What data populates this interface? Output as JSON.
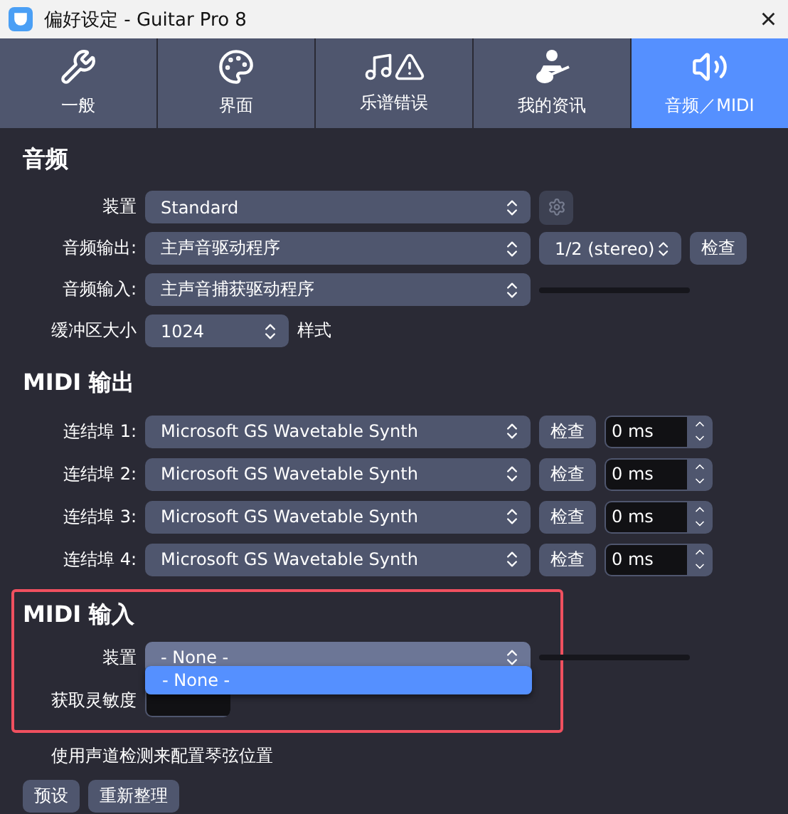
{
  "window": {
    "title": "偏好设定 - Guitar Pro 8",
    "close": "×"
  },
  "tabs": [
    {
      "label": "一般",
      "selected": false
    },
    {
      "label": "界面",
      "selected": false
    },
    {
      "label": "乐谱错误",
      "selected": false
    },
    {
      "label": "我的资讯",
      "selected": false
    },
    {
      "label": "音频／MIDI",
      "selected": true
    }
  ],
  "audio": {
    "heading": "音频",
    "device": {
      "label": "装置",
      "value": "Standard"
    },
    "output": {
      "label": "音频输出:",
      "value": "主声音驱动程序",
      "channel": "1/2 (stereo)",
      "test": "检查"
    },
    "input": {
      "label": "音频输入:",
      "value": "主声音捕获驱动程序"
    },
    "buffer": {
      "label": "缓冲区大小",
      "value": "1024",
      "suffix": "样式"
    }
  },
  "midi_output": {
    "heading": "MIDI 输出",
    "ports": [
      {
        "label": "连结埠 1:",
        "value": "Microsoft GS Wavetable Synth",
        "test": "检查",
        "latency": "0 ms"
      },
      {
        "label": "连结埠 2:",
        "value": "Microsoft GS Wavetable Synth",
        "test": "检查",
        "latency": "0 ms"
      },
      {
        "label": "连结埠 3:",
        "value": "Microsoft GS Wavetable Synth",
        "test": "检查",
        "latency": "0 ms"
      },
      {
        "label": "连结埠 4:",
        "value": "Microsoft GS Wavetable Synth",
        "test": "检查",
        "latency": "0 ms"
      }
    ]
  },
  "midi_input": {
    "heading": "MIDI 输入",
    "device": {
      "label": "装置",
      "value": "- None -",
      "expanded": true,
      "options": [
        {
          "label": "- None -",
          "selected": true
        }
      ]
    },
    "sensitivity": {
      "label": "获取灵敏度"
    }
  },
  "note": "使用声道检测来配置琴弦位置",
  "buttons": [
    "预设",
    "重新整理"
  ]
}
